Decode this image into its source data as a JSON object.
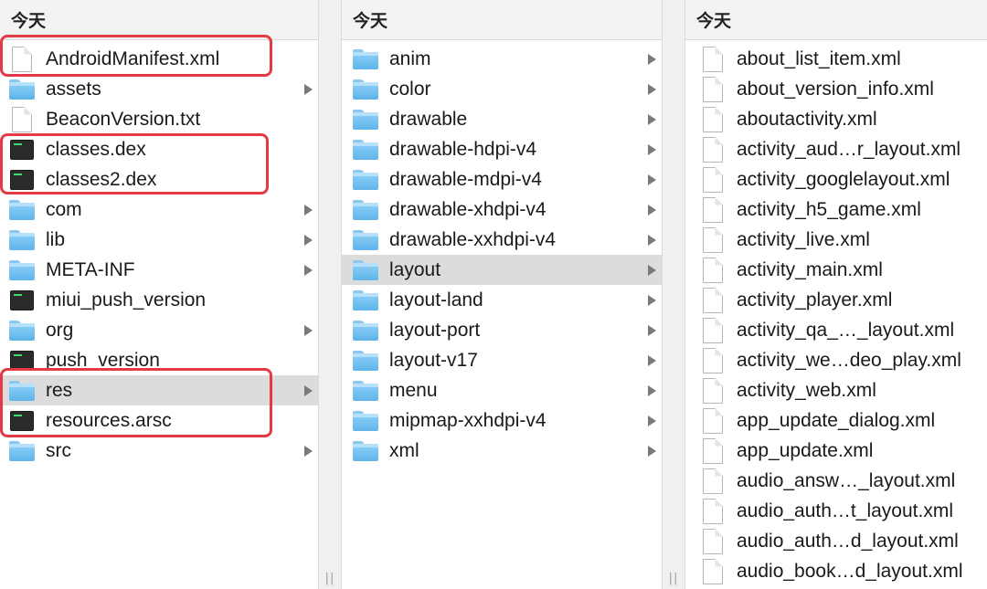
{
  "columns": [
    {
      "header": "今天",
      "items": [
        {
          "label": "AndroidManifest.xml",
          "icon": "document-icon",
          "arrow": false
        },
        {
          "label": "assets",
          "icon": "folder-icon",
          "arrow": true
        },
        {
          "label": "BeaconVersion.txt",
          "icon": "document-icon",
          "arrow": false
        },
        {
          "label": "classes.dex",
          "icon": "executable-icon",
          "arrow": false
        },
        {
          "label": "classes2.dex",
          "icon": "executable-icon",
          "arrow": false
        },
        {
          "label": "com",
          "icon": "folder-icon",
          "arrow": true
        },
        {
          "label": "lib",
          "icon": "folder-icon",
          "arrow": true
        },
        {
          "label": "META-INF",
          "icon": "folder-icon",
          "arrow": true
        },
        {
          "label": "miui_push_version",
          "icon": "executable-icon",
          "arrow": false
        },
        {
          "label": "org",
          "icon": "folder-icon",
          "arrow": true
        },
        {
          "label": "push_version",
          "icon": "executable-icon",
          "arrow": false
        },
        {
          "label": "res",
          "icon": "folder-icon",
          "arrow": true,
          "selected": true
        },
        {
          "label": "resources.arsc",
          "icon": "executable-icon",
          "arrow": false
        },
        {
          "label": "src",
          "icon": "folder-icon",
          "arrow": true
        }
      ]
    },
    {
      "header": "今天",
      "items": [
        {
          "label": "anim",
          "icon": "folder-icon",
          "arrow": true
        },
        {
          "label": "color",
          "icon": "folder-icon",
          "arrow": true
        },
        {
          "label": "drawable",
          "icon": "folder-icon",
          "arrow": true
        },
        {
          "label": "drawable-hdpi-v4",
          "icon": "folder-icon",
          "arrow": true
        },
        {
          "label": "drawable-mdpi-v4",
          "icon": "folder-icon",
          "arrow": true
        },
        {
          "label": "drawable-xhdpi-v4",
          "icon": "folder-icon",
          "arrow": true
        },
        {
          "label": "drawable-xxhdpi-v4",
          "icon": "folder-icon",
          "arrow": true
        },
        {
          "label": "layout",
          "icon": "folder-icon",
          "arrow": true,
          "selected": true
        },
        {
          "label": "layout-land",
          "icon": "folder-icon",
          "arrow": true
        },
        {
          "label": "layout-port",
          "icon": "folder-icon",
          "arrow": true
        },
        {
          "label": "layout-v17",
          "icon": "folder-icon",
          "arrow": true
        },
        {
          "label": "menu",
          "icon": "folder-icon",
          "arrow": true
        },
        {
          "label": "mipmap-xxhdpi-v4",
          "icon": "folder-icon",
          "arrow": true
        },
        {
          "label": "xml",
          "icon": "folder-icon",
          "arrow": true
        }
      ]
    },
    {
      "header": "今天",
      "items": [
        {
          "label": "about_list_item.xml",
          "icon": "document-icon",
          "arrow": false
        },
        {
          "label": "about_version_info.xml",
          "icon": "document-icon",
          "arrow": false
        },
        {
          "label": "aboutactivity.xml",
          "icon": "document-icon",
          "arrow": false
        },
        {
          "label": "activity_aud…r_layout.xml",
          "icon": "document-icon",
          "arrow": false
        },
        {
          "label": "activity_googlelayout.xml",
          "icon": "document-icon",
          "arrow": false
        },
        {
          "label": "activity_h5_game.xml",
          "icon": "document-icon",
          "arrow": false
        },
        {
          "label": "activity_live.xml",
          "icon": "document-icon",
          "arrow": false
        },
        {
          "label": "activity_main.xml",
          "icon": "document-icon",
          "arrow": false
        },
        {
          "label": "activity_player.xml",
          "icon": "document-icon",
          "arrow": false
        },
        {
          "label": "activity_qa_…_layout.xml",
          "icon": "document-icon",
          "arrow": false
        },
        {
          "label": "activity_we…deo_play.xml",
          "icon": "document-icon",
          "arrow": false
        },
        {
          "label": "activity_web.xml",
          "icon": "document-icon",
          "arrow": false
        },
        {
          "label": "app_update_dialog.xml",
          "icon": "document-icon",
          "arrow": false
        },
        {
          "label": "app_update.xml",
          "icon": "document-icon",
          "arrow": false
        },
        {
          "label": "audio_answ…_layout.xml",
          "icon": "document-icon",
          "arrow": false
        },
        {
          "label": "audio_auth…t_layout.xml",
          "icon": "document-icon",
          "arrow": false
        },
        {
          "label": "audio_auth…d_layout.xml",
          "icon": "document-icon",
          "arrow": false
        },
        {
          "label": "audio_book…d_layout.xml",
          "icon": "document-icon",
          "arrow": false
        }
      ]
    }
  ],
  "colors": {
    "highlight_border": "#e63946",
    "selection": "#dcdcdc",
    "folder": "#6fc0f0"
  }
}
